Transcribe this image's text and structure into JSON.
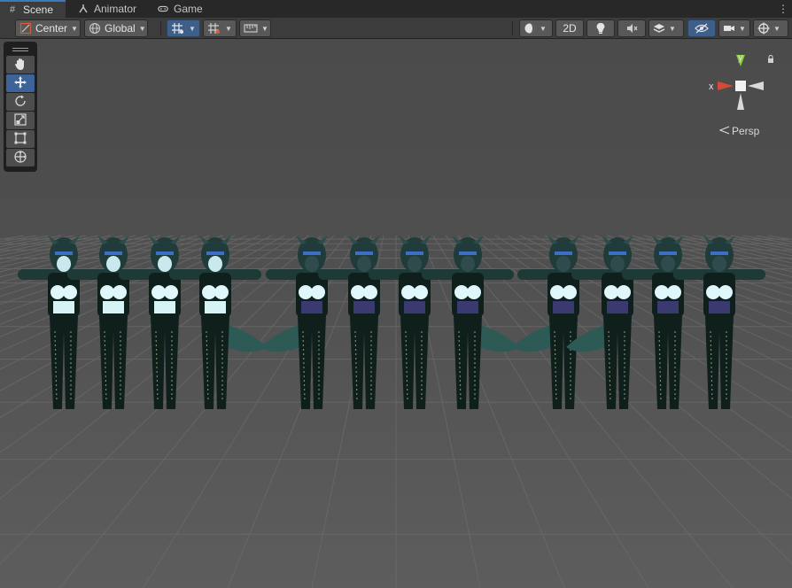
{
  "tabs": [
    {
      "label": "Scene",
      "icon": "scene-grid-icon",
      "active": true
    },
    {
      "label": "Animator",
      "icon": "animator-icon",
      "active": false
    },
    {
      "label": "Game",
      "icon": "gamepad-icon",
      "active": false
    }
  ],
  "toolbar": {
    "pivot_label": "Center",
    "space_label": "Global",
    "mode_2d_label": "2D"
  },
  "gizmo": {
    "y_label": "y",
    "x_label": "x",
    "projection_label": "Persp"
  },
  "colors": {
    "tab_bar": "#282828",
    "panel": "#3c3c3c",
    "accent_blue": "#3e5f8a",
    "gizmo_x": "#d44a3a",
    "gizmo_y": "#8ccd3c",
    "character_skin": "#dff7fb",
    "character_body": "#0f1f1b"
  },
  "scene": {
    "character_count": 12,
    "group_count": 3
  }
}
